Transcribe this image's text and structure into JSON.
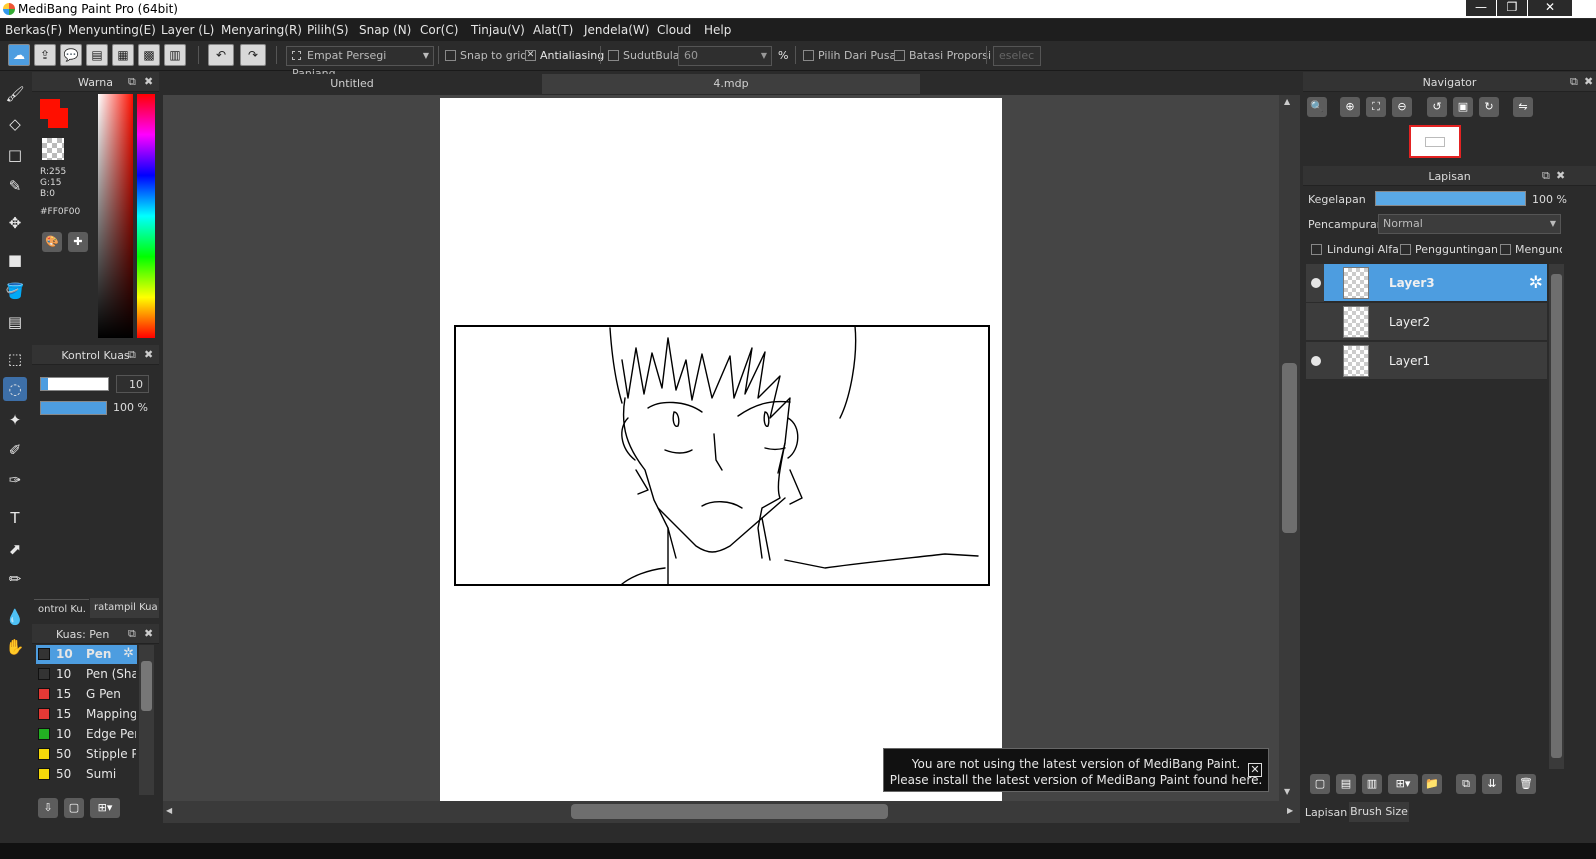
{
  "window": {
    "title": "MediBang Paint Pro (64bit)",
    "minimize": "—",
    "maximize": "❐",
    "close": "✕"
  },
  "menu": [
    "Berkas(F)",
    "Menyunting(E)",
    "Layer (L)",
    "Menyaring(R)",
    "Pilih(S)",
    "Snap (N)",
    "Cor(C)",
    "Tinjau(V)",
    "Alat(T)",
    "Jendela(W)",
    "Cloud",
    "Help"
  ],
  "toolbar": {
    "selection_shape": "Empat Persegi Panjang",
    "snap_to_grid": "Snap to grid",
    "antialiasing": "Antialiasing",
    "sudut_bulat": "SudutBulat",
    "sudut_value": "60",
    "percent": "%",
    "pilih_dari_pusat": "Pilih Dari Pusat",
    "batasi_proporsi": "Batasi Proporsi",
    "deselect": "eselec"
  },
  "color_panel": {
    "title": "Warna",
    "r": "R:255",
    "g": "G:15",
    "b": "B:0",
    "hex": "#FF0F00",
    "primary": "#ff0f00"
  },
  "brush_control": {
    "title": "Kontrol Kuas",
    "size": "10",
    "opacity": "100 %",
    "size_fraction": 0.1,
    "opacity_fraction": 1.0
  },
  "panel_tabs": [
    "ontrol Ku.",
    "ratampil Kua"
  ],
  "brush_panel": {
    "title": "Kuas: Pen",
    "items": [
      {
        "size": "10",
        "name": "Pen",
        "color": "#333333"
      },
      {
        "size": "10",
        "name": "Pen (Sha",
        "color": "#333333"
      },
      {
        "size": "15",
        "name": "G Pen",
        "color": "#e53935"
      },
      {
        "size": "15",
        "name": "Mapping I",
        "color": "#e53935"
      },
      {
        "size": "10",
        "name": "Edge Pen",
        "color": "#22b022"
      },
      {
        "size": "50",
        "name": "Stipple P",
        "color": "#f5d90a"
      },
      {
        "size": "50",
        "name": "Sumi",
        "color": "#f5d90a"
      }
    ]
  },
  "canvas_tabs": [
    "Untitled",
    "4.mdp"
  ],
  "notice": {
    "line1": "You are not using the latest version of MediBang Paint.",
    "line2": "Please install the latest version of MediBang Paint found here.",
    "close": "✕"
  },
  "navigator": {
    "title": "Navigator"
  },
  "layers_panel": {
    "title": "Lapisan",
    "opacity_label": "Kegelapan",
    "opacity_value": "100 %",
    "opacity_fraction": 1.0,
    "blend_label": "Pencampuran",
    "blend_value": "Normal",
    "protect_alpha": "Lindungi Alfa",
    "clipping": "Pengguntingan",
    "lock": "Mengunci",
    "layers": [
      {
        "name": "Layer3",
        "selected": true,
        "visible": true
      },
      {
        "name": "Layer2",
        "selected": false,
        "visible": false
      },
      {
        "name": "Layer1",
        "selected": false,
        "visible": true
      }
    ]
  },
  "bottom_tabs": [
    "Lapisan",
    "Brush Size"
  ]
}
